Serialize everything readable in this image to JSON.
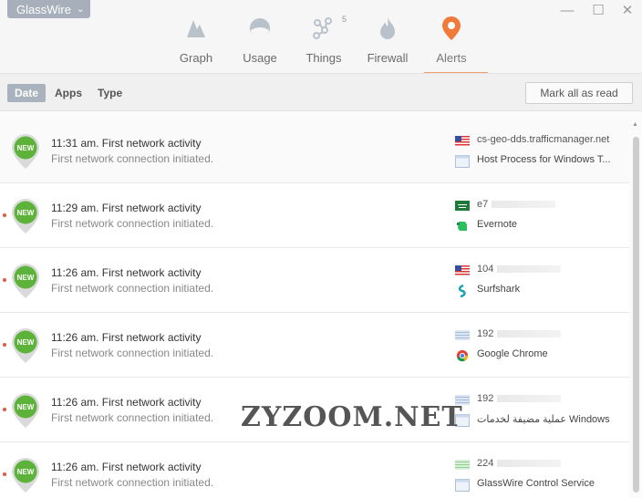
{
  "app": {
    "name": "GlassWire"
  },
  "nav": {
    "tabs": [
      {
        "label": "Graph"
      },
      {
        "label": "Usage"
      },
      {
        "label": "Things",
        "badge": "5"
      },
      {
        "label": "Firewall"
      },
      {
        "label": "Alerts",
        "active": true
      }
    ]
  },
  "filters": {
    "date": "Date",
    "apps": "Apps",
    "type": "Type",
    "mark_all": "Mark all as read"
  },
  "alerts": [
    {
      "time_title": "11:31 am. First network activity",
      "detail": "First network connection initiated.",
      "host": "cs-geo-dds.trafficmanager.net",
      "app": "Host Process for Windows T...",
      "flag": "us",
      "app_icon": "window-icon",
      "unread": false
    },
    {
      "time_title": "11:29 am. First network activity",
      "detail": "First network connection initiated.",
      "host": "e7",
      "app": "Evernote",
      "flag": "sa",
      "app_icon": "evernote-icon",
      "unread": true
    },
    {
      "time_title": "11:26 am. First network activity",
      "detail": "First network connection initiated.",
      "host": "104",
      "app": "Surfshark",
      "flag": "us",
      "app_icon": "surfshark-icon",
      "unread": true
    },
    {
      "time_title": "11:26 am. First network activity",
      "detail": "First network connection initiated.",
      "host": "192",
      "app": "Google Chrome",
      "flag": "local",
      "app_icon": "chrome-icon",
      "unread": true
    },
    {
      "time_title": "11:26 am. First network activity",
      "detail": "First network connection initiated.",
      "host": "192",
      "app": "عملية مضيفة لخدمات Windows",
      "flag": "local",
      "app_icon": "window-icon",
      "unread": true
    },
    {
      "time_title": "11:26 am. First network activity",
      "detail": "First network connection initiated.",
      "host": "224",
      "app": "GlassWire Control Service",
      "flag": "local-green",
      "app_icon": "window-icon",
      "unread": true
    }
  ],
  "badge_text": "NEW",
  "watermark": "ZYZOOM.NET",
  "colors": {
    "accent": "#f07a3a",
    "new_badge": "#5db33a",
    "filter_selected": "#a9b3bd"
  }
}
